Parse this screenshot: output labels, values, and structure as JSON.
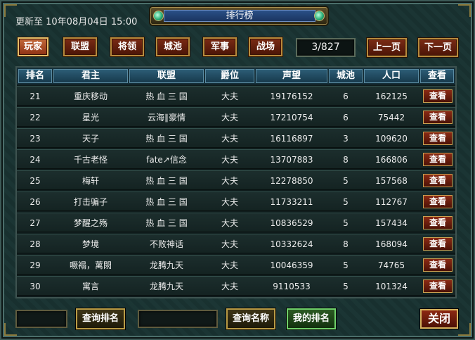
{
  "window": {
    "title": "排行榜",
    "update_text": "更新至 10年08月04日 15:00"
  },
  "tabs": [
    {
      "label": "玩家",
      "active": true
    },
    {
      "label": "联盟",
      "active": false
    },
    {
      "label": "将领",
      "active": false
    },
    {
      "label": "城池",
      "active": false
    },
    {
      "label": "军事",
      "active": false
    },
    {
      "label": "战场",
      "active": false
    }
  ],
  "pagination": {
    "indicator": "3/827",
    "prev_label": "上一页",
    "next_label": "下一页"
  },
  "table": {
    "headers": [
      "排名",
      "君主",
      "联盟",
      "爵位",
      "声望",
      "城池",
      "人口",
      "查看"
    ],
    "rows": [
      {
        "rank": "21",
        "lord": "重庆移动",
        "alliance": "热 血 三 国",
        "title": "大夫",
        "prestige": "19176152",
        "cities": "6",
        "population": "162125",
        "view": "查看"
      },
      {
        "rank": "22",
        "lord": "星光",
        "alliance": "云海∥豪情",
        "title": "大夫",
        "prestige": "17210754",
        "cities": "6",
        "population": "75442",
        "view": "查看"
      },
      {
        "rank": "23",
        "lord": "天子",
        "alliance": "热 血 三 国",
        "title": "大夫",
        "prestige": "16116897",
        "cities": "3",
        "population": "109620",
        "view": "查看"
      },
      {
        "rank": "24",
        "lord": "千古老怪",
        "alliance": "fate↗信念",
        "title": "大夫",
        "prestige": "13707883",
        "cities": "8",
        "population": "166806",
        "view": "查看"
      },
      {
        "rank": "25",
        "lord": "梅轩",
        "alliance": "热 血 三 国",
        "title": "大夫",
        "prestige": "12278850",
        "cities": "5",
        "population": "157568",
        "view": "查看"
      },
      {
        "rank": "26",
        "lord": "打击骗子",
        "alliance": "热 血 三 国",
        "title": "大夫",
        "prestige": "11733211",
        "cities": "5",
        "population": "112767",
        "view": "查看"
      },
      {
        "rank": "27",
        "lord": "梦醒之殇",
        "alliance": "热 血 三 国",
        "title": "大夫",
        "prestige": "10836529",
        "cities": "5",
        "population": "157434",
        "view": "查看"
      },
      {
        "rank": "28",
        "lord": "梦境",
        "alliance": "不败神话",
        "title": "大夫",
        "prestige": "10332624",
        "cities": "8",
        "population": "168094",
        "view": "查看"
      },
      {
        "rank": "29",
        "lord": "噘褟，蓠閖",
        "alliance": "龙腾九天",
        "title": "大夫",
        "prestige": "10046359",
        "cities": "5",
        "population": "74765",
        "view": "查看"
      },
      {
        "rank": "30",
        "lord": "寓言",
        "alliance": "龙腾九天",
        "title": "大夫",
        "prestige": "9110533",
        "cities": "5",
        "population": "101324",
        "view": "查看"
      }
    ]
  },
  "bottom": {
    "rank_input_value": "",
    "query_rank_label": "查询排名",
    "name_input_value": "",
    "query_name_label": "查询名称",
    "my_rank_label": "我的排名",
    "close_label": "关闭"
  },
  "colors": {
    "accent_gold": "#b88a3c",
    "button_red": "#7a2a14",
    "header_blue": "#2c5d76",
    "my_rank_green": "#6fd06a"
  }
}
